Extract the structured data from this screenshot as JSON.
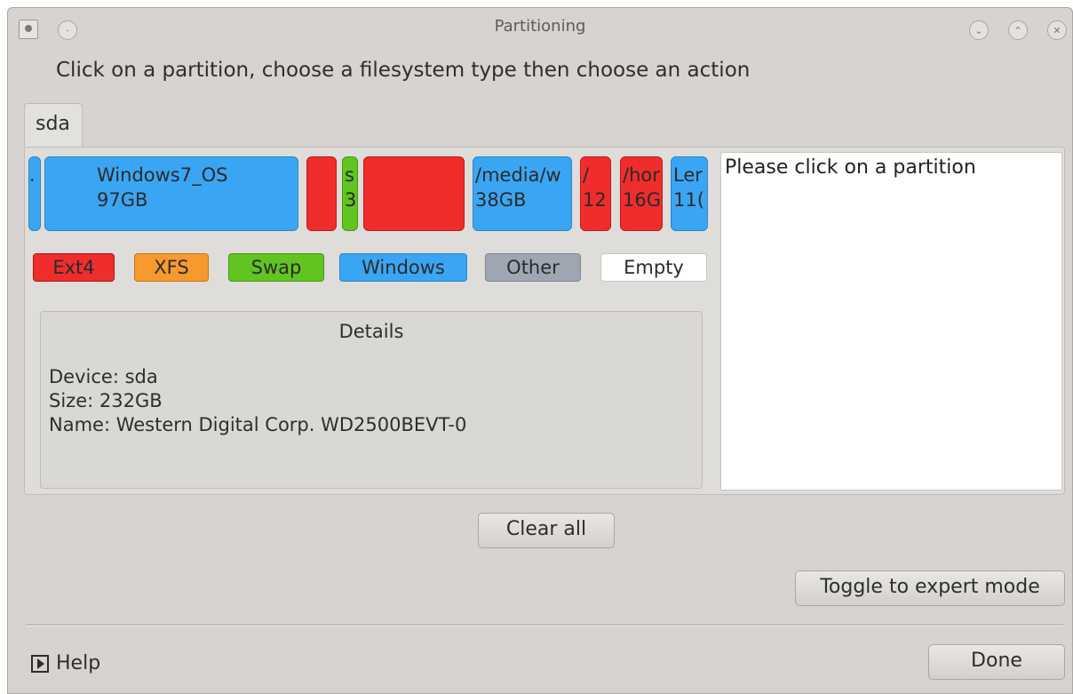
{
  "window": {
    "title": "Partitioning"
  },
  "instruction": "Click on a partition, choose a filesystem type then choose an action",
  "tabs": [
    {
      "label": "sda"
    }
  ],
  "partitions": [
    {
      "type": "Windows",
      "line1": ".",
      "line2": ""
    },
    {
      "type": "Windows",
      "line1": "Windows7_OS",
      "line2": "97GB"
    },
    {
      "type": "Ext4",
      "line1": "",
      "line2": ""
    },
    {
      "type": "Swap",
      "line1": "s",
      "line2": "3"
    },
    {
      "type": "Ext4",
      "line1": "",
      "line2": ""
    },
    {
      "type": "Windows",
      "line1": "/media/w",
      "line2": "38GB"
    },
    {
      "type": "Ext4",
      "line1": "/",
      "line2": "12"
    },
    {
      "type": "Ext4",
      "line1": "/hor",
      "line2": "16G"
    },
    {
      "type": "Windows",
      "line1": "Ler",
      "line2": "11("
    }
  ],
  "legend": {
    "ext4": "Ext4",
    "xfs": "XFS",
    "swap": "Swap",
    "windows": "Windows",
    "other": "Other",
    "empty": "Empty"
  },
  "colors": {
    "ext4": "#ef2d2d",
    "xfs": "#f79a2e",
    "swap": "#62c421",
    "windows": "#3aa6f3",
    "other": "#9ea7b1",
    "empty": "#ffffff"
  },
  "details": {
    "title": "Details",
    "device": "Device: sda",
    "size": "Size: 232GB",
    "name": "Name: Western Digital Corp. WD2500BEVT-0"
  },
  "info": "Please click on a partition",
  "buttons": {
    "clear_all": "Clear all",
    "expert": "Toggle to expert mode",
    "done": "Done",
    "help": "Help"
  },
  "icons": {
    "app": "partition-app-icon",
    "pin": "pin-icon",
    "minimize": "chevron-down-icon",
    "maximize": "chevron-up-icon",
    "close": "close-icon",
    "help": "play-arrow-icon"
  }
}
